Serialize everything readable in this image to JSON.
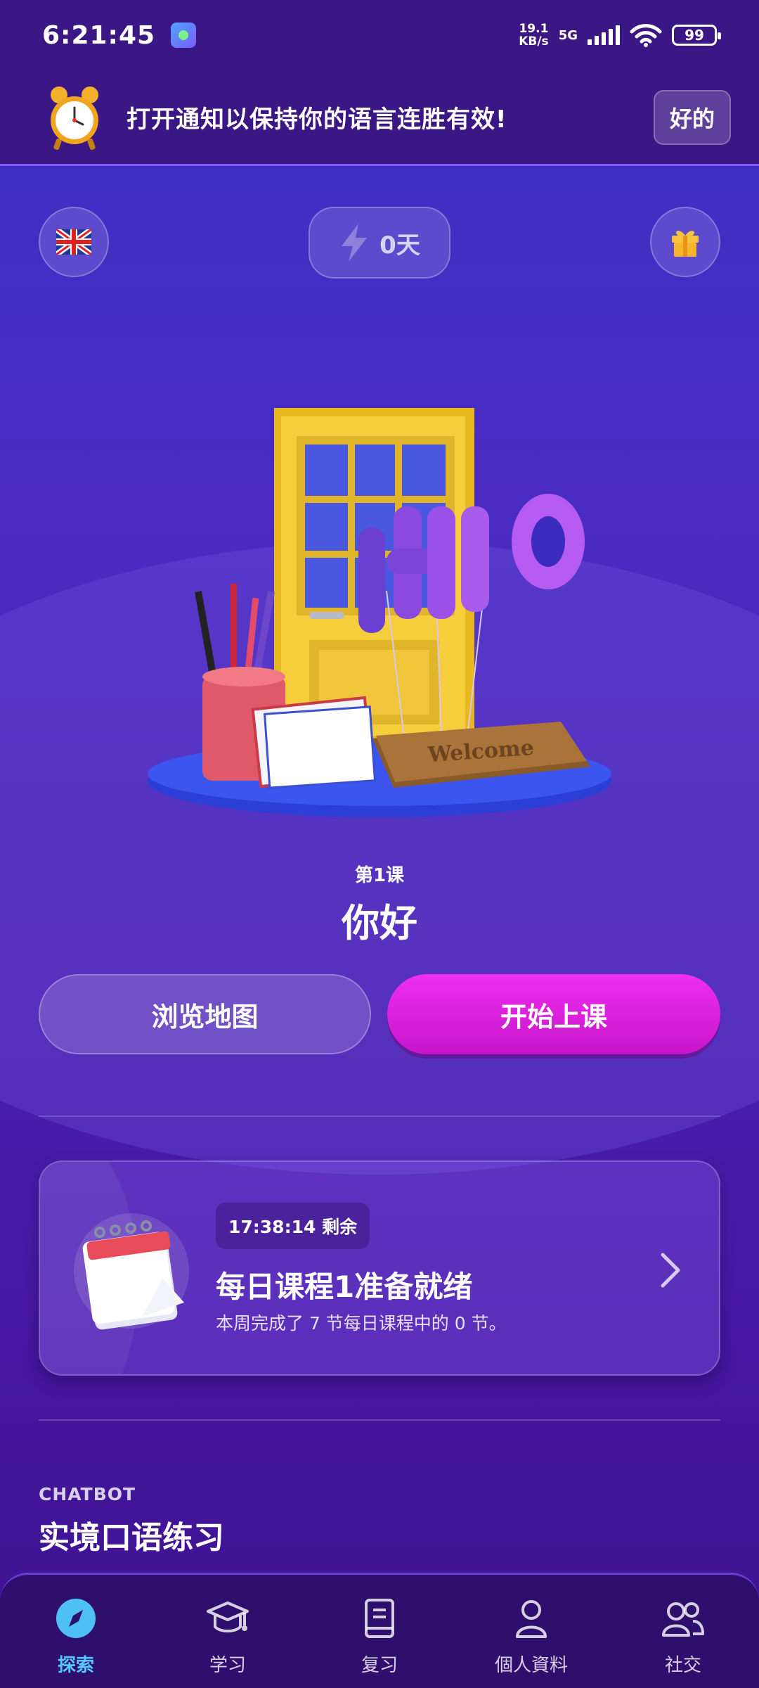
{
  "status_bar": {
    "time": "6:21:45",
    "speed_value": "19.1",
    "speed_unit": "KB/s",
    "network": "5G",
    "battery": "99"
  },
  "banner": {
    "text": "打开通知以保持你的语言连胜有效!",
    "ok_label": "好的"
  },
  "top_bar": {
    "language_icon": "uk-flag-icon",
    "streak_value": "0天",
    "gift_icon": "gift-icon"
  },
  "lesson": {
    "number": "第1课",
    "title": "你好",
    "map_button": "浏览地图",
    "start_button": "开始上课"
  },
  "daily_card": {
    "timer": "17:38:14 剩余",
    "title": "每日课程1准备就绪",
    "subtitle": "本周完成了 7 节每日课程中的 0 节。"
  },
  "chatbot": {
    "label": "CHATBOT",
    "title": "实境口语练习"
  },
  "nav": {
    "items": [
      {
        "label": "探索",
        "icon": "compass-icon",
        "active": true
      },
      {
        "label": "学习",
        "icon": "graduation-cap-icon",
        "active": false
      },
      {
        "label": "复习",
        "icon": "book-icon",
        "active": false
      },
      {
        "label": "個人資料",
        "icon": "person-icon",
        "active": false
      },
      {
        "label": "社交",
        "icon": "people-icon",
        "active": false
      }
    ]
  },
  "colors": {
    "accent": "#e325e6",
    "active_nav": "#55c8ff",
    "background": "#4a2cc2"
  }
}
